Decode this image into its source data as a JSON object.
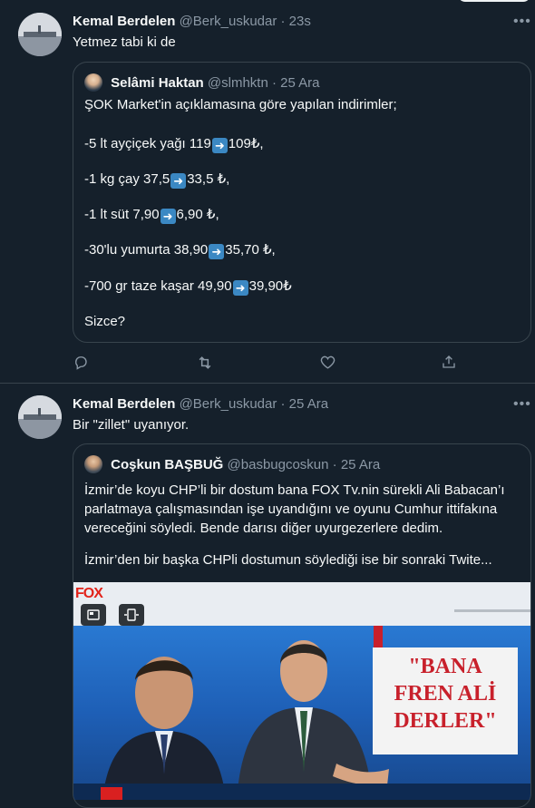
{
  "tweet1": {
    "name": "Kemal Berdelen",
    "handle": "@Berk_uskudar",
    "time": "· 23s",
    "text": "Yetmez tabi ki de",
    "quote": {
      "name": "Selâmi Haktan",
      "handle": "@slmhktn",
      "time": "· 25 Ara",
      "intro": "ŞOK Market'in açıklamasına göre yapılan indirimler;",
      "items": [
        {
          "before": "-5 lt ayçiçek yağı 119",
          "after": "109₺,"
        },
        {
          "before": "-1 kg çay 37,5",
          "after": "33,5 ₺,"
        },
        {
          "before": "-1 lt süt 7,90",
          "after": "6,90 ₺,"
        },
        {
          "before": "-30'lu yumurta 38,90",
          "after": "35,70 ₺,"
        },
        {
          "before": "-700 gr taze kaşar 49,90",
          "after": "39,90₺"
        }
      ],
      "outro": "Sizce?"
    }
  },
  "tweet2": {
    "name": "Kemal Berdelen",
    "handle": "@Berk_uskudar",
    "time": "· 25 Ara",
    "text": "Bir \"zillet\" uyanıyor.",
    "quote": {
      "name": "Coşkun BAŞBUĞ",
      "handle": "@basbugcoskun",
      "time": "· 25 Ara",
      "para1": "İzmir’de koyu CHP’li bir dostum bana FOX Tv.nin sürekli Ali Babacan’ı parlatmaya çalışmasından işe uyandığını ve oyunu Cumhur ittifakına vereceğini söyledi. Bende darısı diğer uyurgezerlere dedim.",
      "para2": "İzmir’den bir başka CHPli dostumun söylediği ise bir sonraki Twite...",
      "media": {
        "logo": "FOX",
        "sign_lines": [
          "\"BANA",
          "FREN ALİ",
          "DERLER\""
        ]
      }
    }
  },
  "icons": {
    "reply": "reply-icon",
    "retweet": "retweet-icon",
    "like": "heart-icon",
    "share": "share-icon",
    "more": "more-icon",
    "arrow": "right-arrow-emoji"
  },
  "colors": {
    "background": "#15202b",
    "border": "#38444d",
    "muted": "#8b98a5",
    "text": "#f7f9f9",
    "arrow": "#3b88c3"
  }
}
